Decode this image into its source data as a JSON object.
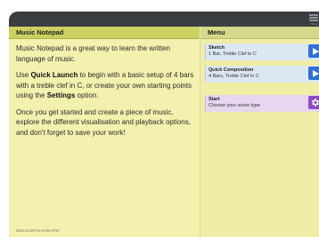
{
  "app": {
    "panel_title": "Music Notepad",
    "menu_title": "Menu",
    "topbar_caption": "Menu"
  },
  "content": {
    "p1": "Music Notepad is a great way to learn the written language of music.",
    "p2_before": "Use ",
    "p2_bold1": "Quick Launch",
    "p2_middle": " to begin with a basic setup of 4 bars with a treble clef in C, or create your own starting points using the ",
    "p2_bold2": "Settings",
    "p2_after": " option.",
    "p3": "Once you get started and create a piece of music, explore the different visualisation and playback options, and don't forget to save your work!"
  },
  "timestamp": "2021-01-05T14:19:35.279Z",
  "menu": {
    "items": [
      {
        "title": "Sketch",
        "subtitle": "1 Bar, Treble Clef in C",
        "icon": "play-icon",
        "color": "#2f6fd6"
      },
      {
        "title": "Quick Composition",
        "subtitle": "4 Bars, Treble Clef in C",
        "icon": "play-icon",
        "color": "#2f6fd6"
      },
      {
        "title": "Start",
        "subtitle": "Choose your score type",
        "icon": "gear-icon",
        "color": "#8e4bc8"
      }
    ]
  },
  "colors": {
    "left_header": "#ccd060",
    "panel_bg": "#f4f0ae",
    "topbar": "#3a3d41"
  }
}
